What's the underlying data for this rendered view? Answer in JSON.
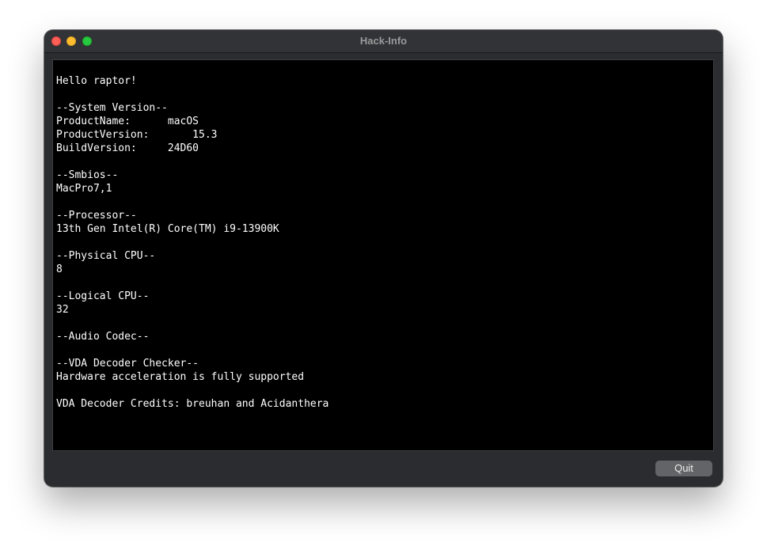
{
  "window": {
    "title": "Hack-Info"
  },
  "console": {
    "text": "Hello raptor!\n\n--System Version--\nProductName:      macOS\nProductVersion:       15.3\nBuildVersion:     24D60\n\n--Smbios--\nMacPro7,1\n\n--Processor--\n13th Gen Intel(R) Core(TM) i9-13900K\n\n--Physical CPU--\n8\n\n--Logical CPU--\n32\n\n--Audio Codec--\n\n--VDA Decoder Checker--\nHardware acceleration is fully supported\n\nVDA Decoder Credits: breuhan and Acidanthera"
  },
  "buttons": {
    "quit_label": "Quit"
  }
}
